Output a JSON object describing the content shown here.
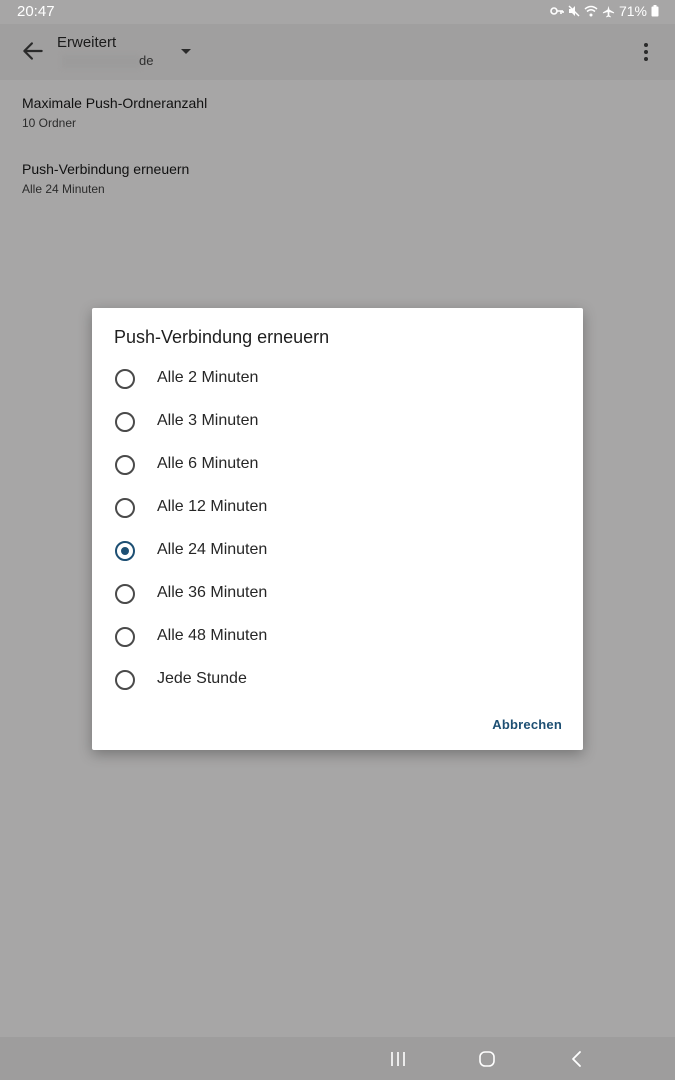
{
  "status_bar": {
    "time": "20:47",
    "battery_percent": "71%",
    "icons": [
      "vpn-key-icon",
      "mute-icon",
      "wifi-icon",
      "airplane-mode-icon",
      "battery-icon"
    ]
  },
  "app_bar": {
    "title": "Erweitert",
    "subtitle_suffix": "de",
    "icons": [
      "back-arrow-icon",
      "dropdown-arrow-icon",
      "overflow-menu-icon"
    ]
  },
  "settings": [
    {
      "title": "Maximale Push-Ordneranzahl",
      "summary": "10 Ordner"
    },
    {
      "title": "Push-Verbindung erneuern",
      "summary": "Alle 24 Minuten"
    }
  ],
  "dialog": {
    "title": "Push-Verbindung erneuern",
    "options": [
      {
        "label": "Alle 2 Minuten",
        "selected": false
      },
      {
        "label": "Alle 3 Minuten",
        "selected": false
      },
      {
        "label": "Alle 6 Minuten",
        "selected": false
      },
      {
        "label": "Alle 12 Minuten",
        "selected": false
      },
      {
        "label": "Alle 24 Minuten",
        "selected": true
      },
      {
        "label": "Alle 36 Minuten",
        "selected": false
      },
      {
        "label": "Alle 48 Minuten",
        "selected": false
      },
      {
        "label": "Jede Stunde",
        "selected": false
      }
    ],
    "cancel_label": "Abbrechen"
  },
  "nav_bar": {
    "icons": [
      "recent-apps-icon",
      "home-icon",
      "back-icon"
    ]
  },
  "colors": {
    "accent": "#1d4f73",
    "scrim_background": "#a7a6a6",
    "dialog_background": "#ffffff"
  }
}
